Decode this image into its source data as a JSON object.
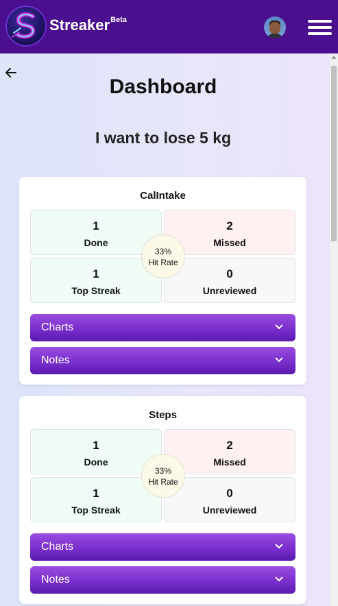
{
  "app": {
    "brand": "Streaker",
    "badge": "Beta"
  },
  "page": {
    "title": "Dashboard",
    "goal": "I want to lose 5 kg"
  },
  "habits": [
    {
      "name": "CalIntake",
      "done": "1",
      "done_label": "Done",
      "missed": "2",
      "missed_label": "Missed",
      "top_streak": "1",
      "top_streak_label": "Top Streak",
      "unreviewed": "0",
      "unreviewed_label": "Unreviewed",
      "hit_rate": "33%",
      "hit_rate_label": "Hit Rate",
      "charts_label": "Charts",
      "notes_label": "Notes"
    },
    {
      "name": "Steps",
      "done": "1",
      "done_label": "Done",
      "missed": "2",
      "missed_label": "Missed",
      "top_streak": "1",
      "top_streak_label": "Top Streak",
      "unreviewed": "0",
      "unreviewed_label": "Unreviewed",
      "hit_rate": "33%",
      "hit_rate_label": "Hit Rate",
      "charts_label": "Charts",
      "notes_label": "Notes"
    }
  ],
  "colors": {
    "header": "#4a0e8f",
    "accordion": "#7a2fcc",
    "done_bg": "#f0fcf5",
    "missed_bg": "#fff1f2"
  },
  "icons": {
    "logo": "streaker-s-logo",
    "back": "arrow-left-icon",
    "menu": "hamburger-icon",
    "chevron": "chevron-down-icon"
  }
}
